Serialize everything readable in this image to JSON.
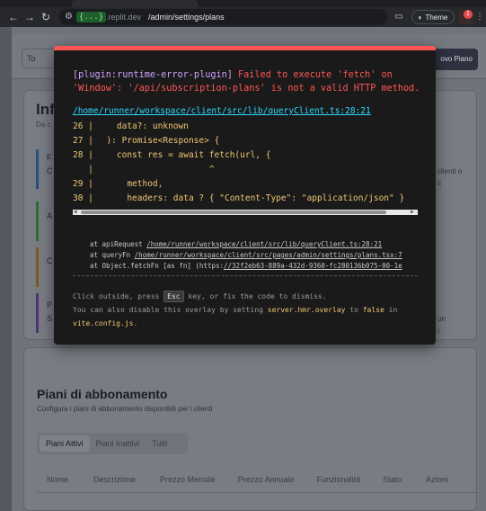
{
  "browser": {
    "host_pill": "{...}",
    "host_rest": ".replit.dev",
    "path": "/admin/settings/plans",
    "theme_label": "Theme",
    "notification_count": "1"
  },
  "page": {
    "back_label": "To",
    "new_plan_label": "ovo Piano",
    "card_title": "Inf",
    "card_sub": "Da c",
    "bar_labels": [
      "F",
      "C",
      "A",
      "C",
      "P",
      "S"
    ],
    "side_texts": [
      "clienti o",
      "c",
      "un",
      "i"
    ],
    "plans_title": "Piani di abbonamento",
    "plans_sub": "Configura i piani di abbonamento disponibili per i clienti",
    "tabs": [
      "Piani Attivi",
      "Piani Inattivi",
      "Tutti"
    ],
    "columns": [
      "Nome",
      "Descrizione",
      "Prezzo Mensile",
      "Prezzo Annuale",
      "Funzionalità",
      "Stato",
      "Azioni"
    ]
  },
  "overlay": {
    "plugin": "[plugin:runtime-error-plugin]",
    "message_1": " Failed to execute 'fetch' on",
    "message_2": "'Window': '/api/subscription-plans' is not a valid HTTP method.",
    "file": "/home/runner/workspace/client/src/lib/queryClient.ts:28:21",
    "code": [
      {
        "ln": "26 |",
        "text": "    data?: unknown"
      },
      {
        "ln": "27 |",
        "text": "  ): Promise<Response> {"
      },
      {
        "ln": "28 |",
        "text": "    const res = await fetch(url, {"
      },
      {
        "ln": "   |",
        "text": "                      ^"
      },
      {
        "ln": "29 |",
        "text": "      method,"
      },
      {
        "ln": "30 |",
        "text": "      headers: data ? { \"Content-Type\": \"application/json\" }"
      }
    ],
    "stack": [
      {
        "prefix": "at apiRequest ",
        "link": "/home/runner/workspace/client/src/lib/queryClient.ts:28:21",
        "suffix": ""
      },
      {
        "prefix": "at queryFn ",
        "link": "/home/runner/workspace/client/src/pages/admin/settings/plans.tsx:7",
        "suffix": ""
      },
      {
        "prefix": "at Object.fetchFn [as fn] (https:",
        "link": "//32f2eb63-889a-432d-9360-fc280136b075-00-1e",
        "suffix": ""
      }
    ],
    "tip_1a": "Click outside, press ",
    "tip_key": "Esc",
    "tip_1b": " key, or fix the code to dismiss.",
    "tip_2a": "You can also disable this overlay by setting ",
    "tip_setting": "server.hmr.overlay",
    "tip_2b": " to ",
    "tip_false": "false",
    "tip_2c": " in",
    "tip_file": "vite.config.js",
    "tip_3": "."
  }
}
